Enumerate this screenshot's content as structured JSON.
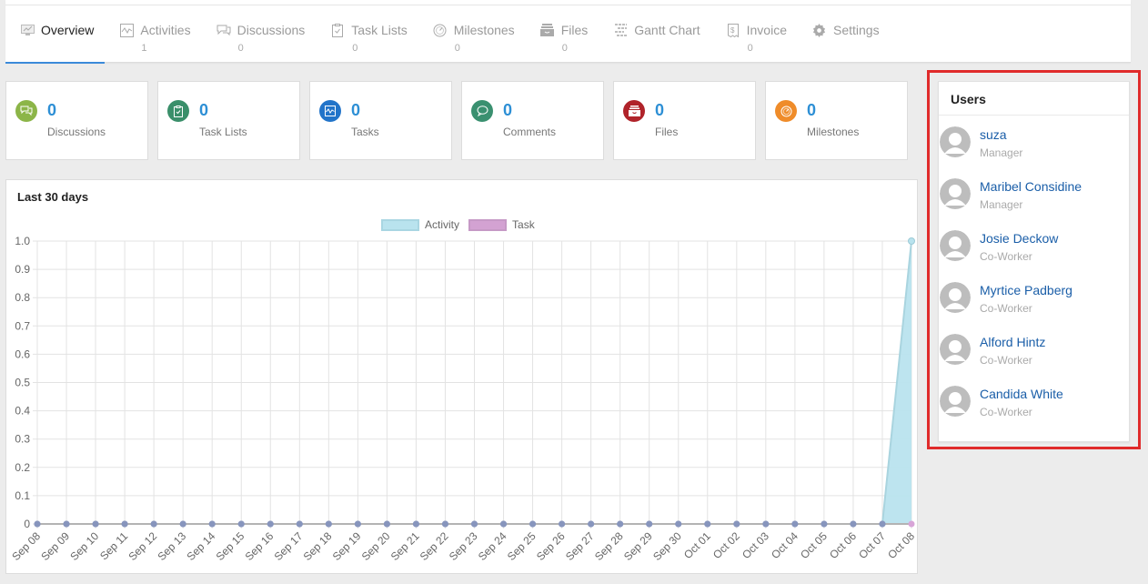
{
  "tabs": [
    {
      "label": "Overview",
      "count": "",
      "icon": "monitor-chart-icon",
      "active": true
    },
    {
      "label": "Activities",
      "count": "1",
      "icon": "activity-icon"
    },
    {
      "label": "Discussions",
      "count": "0",
      "icon": "chat-icon"
    },
    {
      "label": "Task Lists",
      "count": "0",
      "icon": "clipboard-icon"
    },
    {
      "label": "Milestones",
      "count": "0",
      "icon": "gauge-icon"
    },
    {
      "label": "Files",
      "count": "0",
      "icon": "archive-box-icon"
    },
    {
      "label": "Gantt Chart",
      "count": "",
      "icon": "gantt-icon"
    },
    {
      "label": "Invoice",
      "count": "0",
      "icon": "invoice-icon"
    },
    {
      "label": "Settings",
      "count": "",
      "icon": "gear-icon"
    }
  ],
  "stats": [
    {
      "value": "0",
      "label": "Discussions",
      "color": "#8cb548",
      "icon": "chat-icon"
    },
    {
      "value": "0",
      "label": "Task Lists",
      "color": "#3a8f6a",
      "icon": "clipboard-icon"
    },
    {
      "value": "0",
      "label": "Tasks",
      "color": "#2274c9",
      "icon": "activity-icon"
    },
    {
      "value": "0",
      "label": "Comments",
      "color": "#3a9070",
      "icon": "comment-icon"
    },
    {
      "value": "0",
      "label": "Files",
      "color": "#b0232a",
      "icon": "archive-box-icon"
    },
    {
      "value": "0",
      "label": "Milestones",
      "color": "#ef8c2a",
      "icon": "gauge-icon"
    }
  ],
  "chart_card": {
    "title": "Last 30 days"
  },
  "chart_data": {
    "type": "area",
    "title": "Last 30 days",
    "xlabel": "",
    "ylabel": "",
    "ylim": [
      0,
      1.0
    ],
    "yticks": [
      "0",
      "0.1",
      "0.2",
      "0.3",
      "0.4",
      "0.5",
      "0.6",
      "0.7",
      "0.8",
      "0.9",
      "1.0"
    ],
    "grid": true,
    "legend_position": "top-center",
    "x": [
      "Sep 08",
      "Sep 09",
      "Sep 10",
      "Sep 11",
      "Sep 12",
      "Sep 13",
      "Sep 14",
      "Sep 15",
      "Sep 16",
      "Sep 17",
      "Sep 18",
      "Sep 19",
      "Sep 20",
      "Sep 21",
      "Sep 22",
      "Sep 23",
      "Sep 24",
      "Sep 25",
      "Sep 26",
      "Sep 27",
      "Sep 28",
      "Sep 29",
      "Sep 30",
      "Oct 01",
      "Oct 02",
      "Oct 03",
      "Oct 04",
      "Oct 05",
      "Oct 06",
      "Oct 07",
      "Oct 08"
    ],
    "series": [
      {
        "name": "Activity",
        "fill": "#b9e3ee",
        "stroke": "#a5d3e0",
        "values": [
          0,
          0,
          0,
          0,
          0,
          0,
          0,
          0,
          0,
          0,
          0,
          0,
          0,
          0,
          0,
          0,
          0,
          0,
          0,
          0,
          0,
          0,
          0,
          0,
          0,
          0,
          0,
          0,
          0,
          0,
          1
        ]
      },
      {
        "name": "Task",
        "fill": "#d3a2d2",
        "stroke": "#c697c6",
        "values": [
          0,
          0,
          0,
          0,
          0,
          0,
          0,
          0,
          0,
          0,
          0,
          0,
          0,
          0,
          0,
          0,
          0,
          0,
          0,
          0,
          0,
          0,
          0,
          0,
          0,
          0,
          0,
          0,
          0,
          0,
          0
        ]
      }
    ]
  },
  "users_panel": {
    "title": "Users",
    "users": [
      {
        "name": "suza",
        "role": "Manager"
      },
      {
        "name": "Maribel Considine",
        "role": "Manager"
      },
      {
        "name": "Josie Deckow",
        "role": "Co-Worker"
      },
      {
        "name": "Myrtice Padberg",
        "role": "Co-Worker"
      },
      {
        "name": "Alford Hintz",
        "role": "Co-Worker"
      },
      {
        "name": "Candida White",
        "role": "Co-Worker"
      }
    ]
  }
}
